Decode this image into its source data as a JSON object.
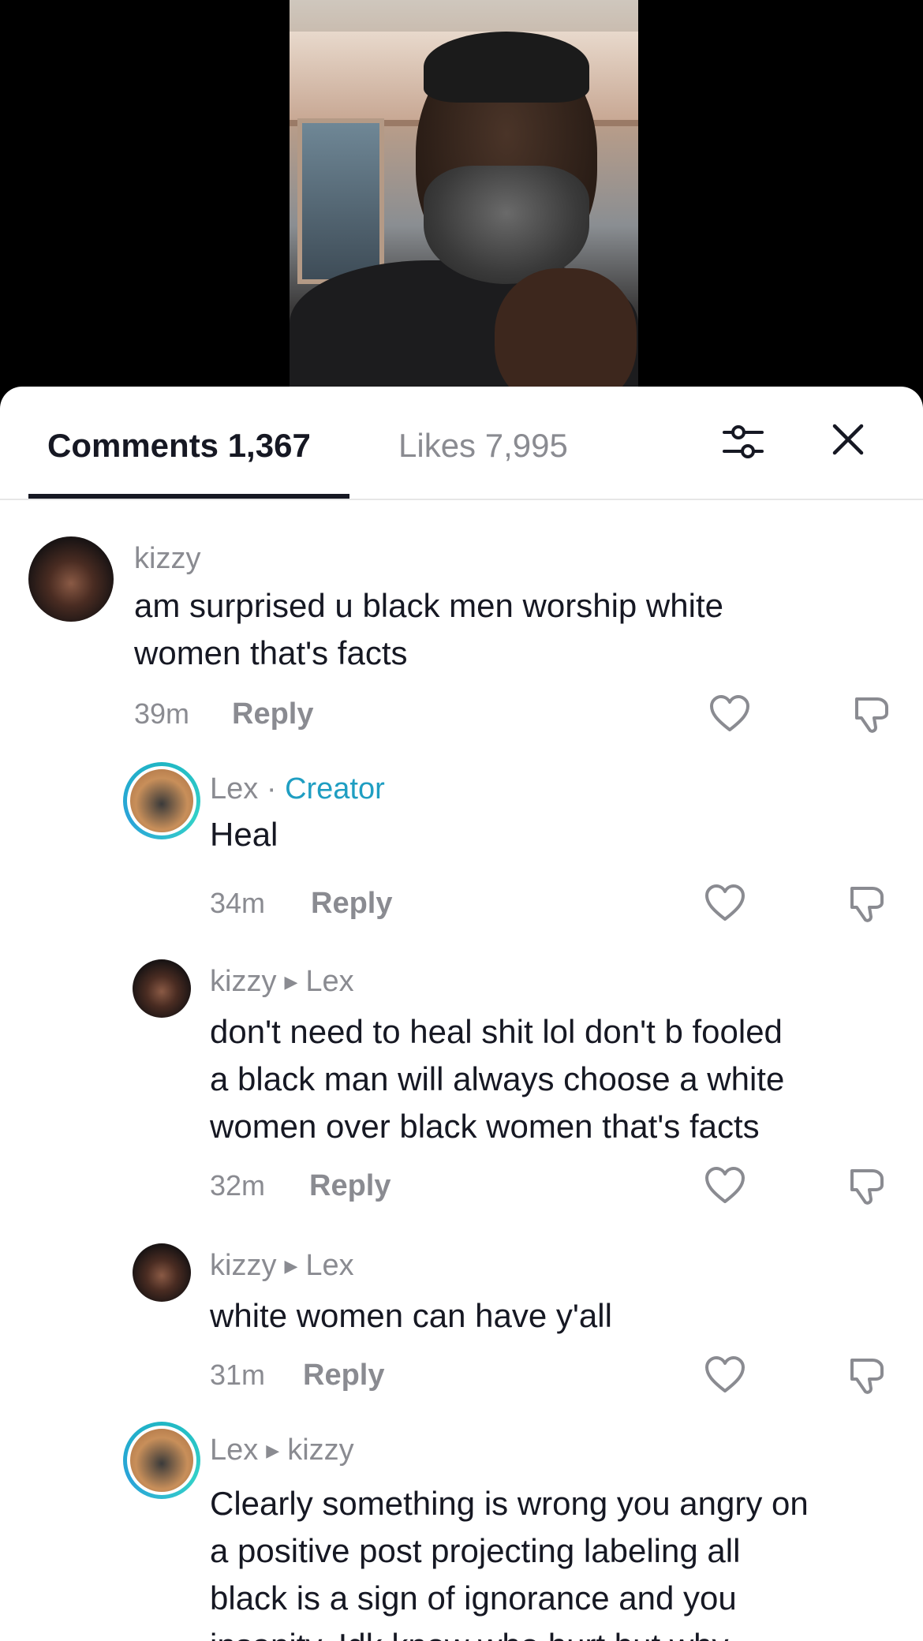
{
  "video": {
    "description_icon": "video-thumbnail"
  },
  "tabs": {
    "comments_label": "Comments 1,367",
    "likes_label": "Likes 7,995",
    "filter_icon": "filter-sliders-icon",
    "close_icon": "close-icon"
  },
  "comments": [
    {
      "username": "kizzy",
      "text_lines": [
        "am surprised u black men worship white",
        "women that's facts"
      ],
      "time": "39m",
      "reply_label": "Reply"
    },
    {
      "username": "Lex",
      "separator": "·",
      "badge": "Creator",
      "text_lines": [
        "Heal"
      ],
      "time": "34m",
      "reply_label": "Reply"
    },
    {
      "username": "kizzy",
      "reply_to": "Lex",
      "text_lines": [
        "don't need to heal shit lol don't b fooled",
        "a black man will always choose a white",
        "women over black women that's facts"
      ],
      "time": "32m",
      "reply_label": "Reply"
    },
    {
      "username": "kizzy",
      "reply_to": "Lex",
      "text_lines": [
        "white women can have y'all"
      ],
      "time": "31m",
      "reply_label": "Reply"
    },
    {
      "username": "Lex",
      "reply_to": "kizzy",
      "text_lines": [
        "Clearly something is wrong you angry on",
        "a positive post projecting labeling all",
        "black is a sign of ignorance and you",
        "insanity. Idk know who hurt but why"
      ]
    }
  ],
  "colors": {
    "creator_badge": "#1f9ec2",
    "secondary_text": "#8a8b91",
    "primary_text": "#161823"
  }
}
